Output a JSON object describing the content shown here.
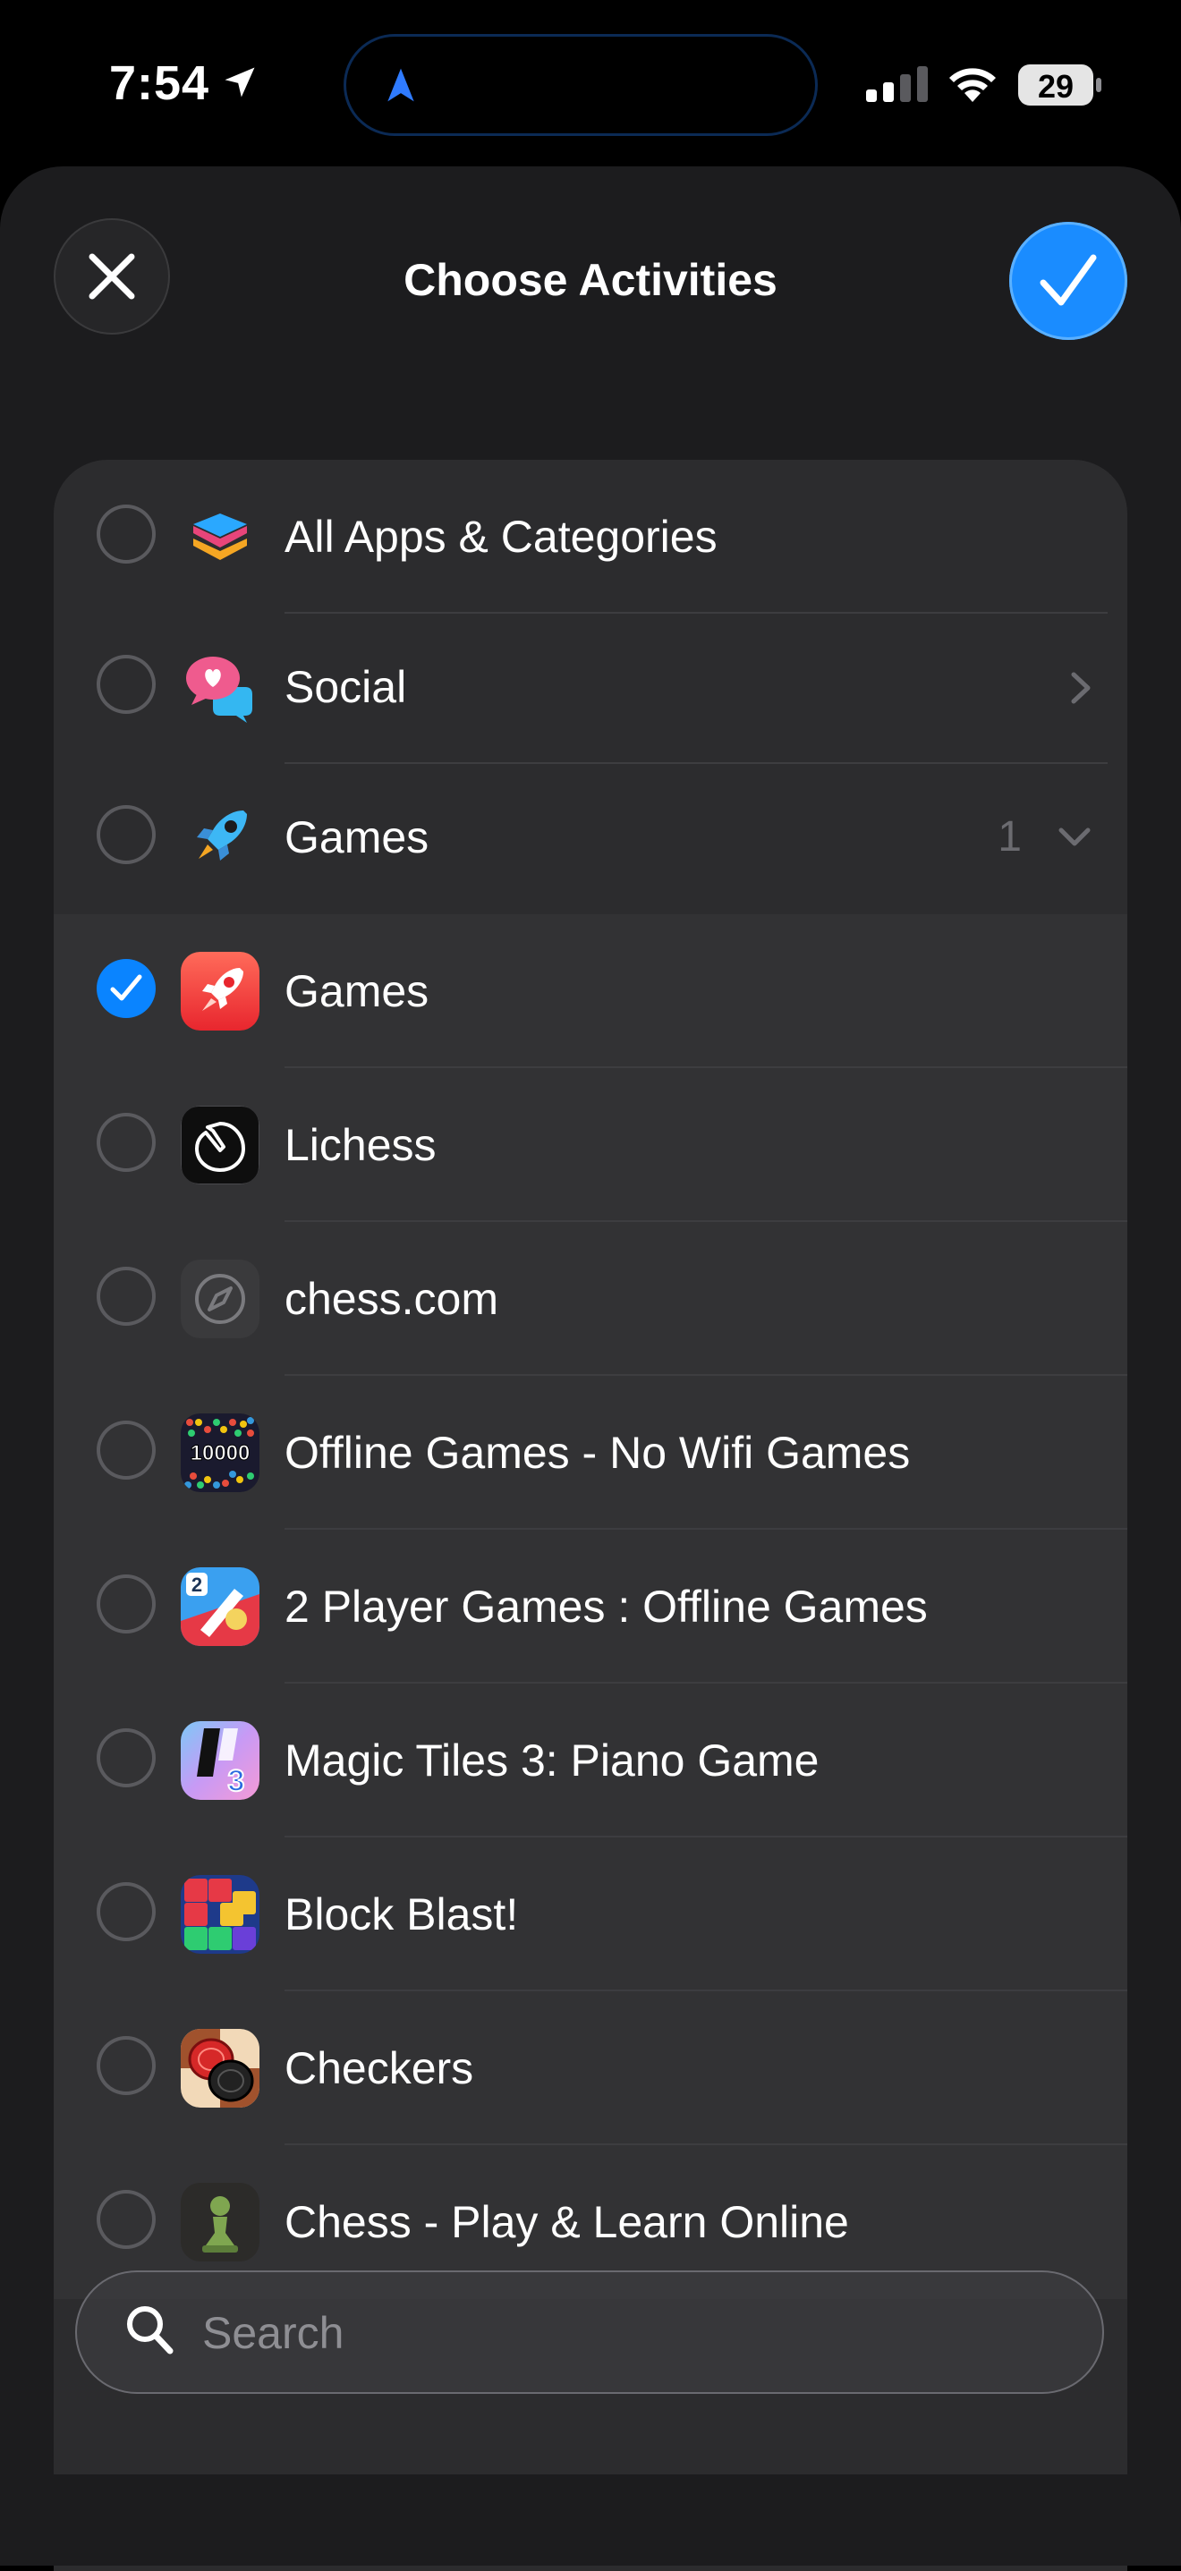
{
  "status_bar": {
    "time": "7:54",
    "battery": "29"
  },
  "sheet": {
    "title": "Choose Activities"
  },
  "rows": [
    {
      "label": "All Apps & Categories",
      "icon": "stack-icon",
      "checked": false
    },
    {
      "label": "Social",
      "icon": "chat-heart-icon",
      "checked": false
    },
    {
      "label": "Games",
      "icon": "rocket-icon",
      "count": "1",
      "checked": false
    },
    {
      "label": "Games",
      "icon": "games-app-icon",
      "checked": true
    },
    {
      "label": "Lichess",
      "icon": "lichess-app-icon",
      "checked": false
    },
    {
      "label": "chess.com",
      "icon": "safari-icon",
      "checked": false
    },
    {
      "label": "Offline Games - No Wifi Games",
      "icon": "offline-games-app-icon",
      "icon_text": "10000",
      "checked": false
    },
    {
      "label": "2 Player Games : Offline Games",
      "icon": "two-player-app-icon",
      "icon_text": "2",
      "checked": false
    },
    {
      "label": "Magic Tiles 3: Piano Game",
      "icon": "magic-tiles-app-icon",
      "icon_text": "3",
      "checked": false
    },
    {
      "label": "Block Blast!",
      "icon": "block-blast-app-icon",
      "checked": false
    },
    {
      "label": "Checkers",
      "icon": "checkers-app-icon",
      "checked": false
    },
    {
      "label": "Chess - Play & Learn Online",
      "icon": "chess-pawn-app-icon",
      "checked": false
    }
  ],
  "search": {
    "placeholder": "Search"
  },
  "colors": {
    "accent": "#0a84ff",
    "sheet_bg": "#1c1c1e",
    "list_bg": "#2c2c2e"
  }
}
